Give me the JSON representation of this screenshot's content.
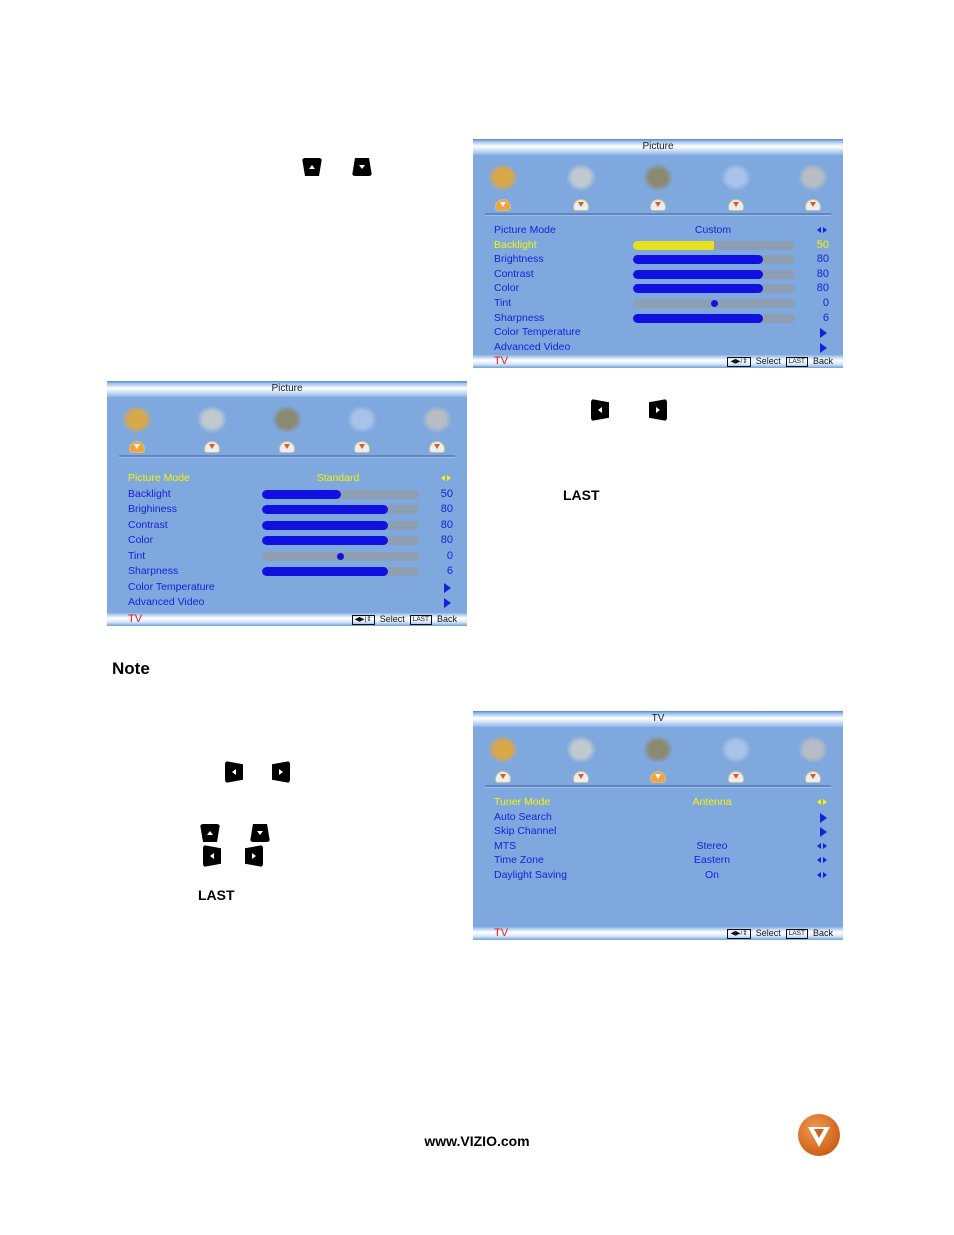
{
  "page": {
    "note_heading": "Note",
    "last_label_1": "LAST",
    "last_label_2": "LAST",
    "footer_url": "www.VIZIO.com",
    "logo": "vizio-logo"
  },
  "key_glyphs": {
    "top_keys": [
      "up-arrow-key",
      "down-arrow-key"
    ],
    "mid_keys": [
      "left-arrow-key",
      "right-arrow-key"
    ],
    "bottom_keys": [
      "left-arrow-key",
      "right-arrow-key",
      "up-arrow-key",
      "down-arrow-key",
      "left-arrow-key",
      "right-arrow-key"
    ]
  },
  "osd_menus": [
    {
      "id": "picture-custom",
      "title": "Picture",
      "active_tab": 0,
      "tabs": [
        "picture-icon",
        "audio-icon",
        "tv-icon",
        "setup-icon",
        "parental-icon"
      ],
      "rows": [
        {
          "label": "Picture Mode",
          "type": "choice",
          "value": "Custom",
          "selected": false
        },
        {
          "label": "Backlight",
          "type": "bar",
          "value": 50,
          "max": 100,
          "display": "50",
          "selected": true
        },
        {
          "label": "Brightness",
          "type": "bar",
          "value": 80,
          "max": 100,
          "display": "80",
          "selected": false
        },
        {
          "label": "Contrast",
          "type": "bar",
          "value": 80,
          "max": 100,
          "display": "80",
          "selected": false
        },
        {
          "label": "Color",
          "type": "bar",
          "value": 80,
          "max": 100,
          "display": "80",
          "selected": false
        },
        {
          "label": "Tint",
          "type": "center",
          "value": 0,
          "min": -50,
          "max": 50,
          "display": "0",
          "selected": false
        },
        {
          "label": "Sharpness",
          "type": "bar",
          "value": 6,
          "max": 7.5,
          "display": "6",
          "selected": false
        },
        {
          "label": "Color Temperature",
          "type": "submenu",
          "selected": false
        },
        {
          "label": "Advanced Video",
          "type": "submenu",
          "selected": false
        }
      ],
      "footer": {
        "source": "TV",
        "select_key": "◀▶/⇕",
        "select_label": "Select",
        "back_key": "LAST",
        "back_label": "Back"
      }
    },
    {
      "id": "picture-standard",
      "title": "Picture",
      "active_tab": 0,
      "tabs": [
        "picture-icon",
        "audio-icon",
        "tv-icon",
        "setup-icon",
        "parental-icon"
      ],
      "rows": [
        {
          "label": "Picture Mode",
          "type": "choice",
          "value": "Standard",
          "selected": true
        },
        {
          "label": "Backlight",
          "type": "bar",
          "value": 50,
          "max": 100,
          "display": "50",
          "selected": false
        },
        {
          "label": "Brighiness",
          "type": "bar",
          "value": 80,
          "max": 100,
          "display": "80",
          "selected": false
        },
        {
          "label": "Contrast",
          "type": "bar",
          "value": 80,
          "max": 100,
          "display": "80",
          "selected": false
        },
        {
          "label": "Color",
          "type": "bar",
          "value": 80,
          "max": 100,
          "display": "80",
          "selected": false
        },
        {
          "label": "Tint",
          "type": "center",
          "value": 0,
          "min": -50,
          "max": 50,
          "display": "0",
          "selected": false
        },
        {
          "label": "Sharpness",
          "type": "bar",
          "value": 6,
          "max": 7.5,
          "display": "6",
          "selected": false
        },
        {
          "label": "Color Temperature",
          "type": "submenu",
          "selected": false
        },
        {
          "label": "Advanced Video",
          "type": "submenu",
          "selected": false
        }
      ],
      "footer": {
        "source": "TV",
        "select_key": "◀▶|⇕",
        "select_label": "Select",
        "back_key": "LAST",
        "back_label": "Back"
      }
    },
    {
      "id": "tv-menu",
      "title": "TV",
      "active_tab": 2,
      "tabs": [
        "picture-icon",
        "audio-icon",
        "tv-icon",
        "setup-icon",
        "parental-icon"
      ],
      "rows": [
        {
          "label": "Tuner Mode",
          "type": "choice",
          "value": "Antenna",
          "selected": true
        },
        {
          "label": "Auto Search",
          "type": "submenu",
          "selected": false
        },
        {
          "label": "Skip Channel",
          "type": "submenu",
          "selected": false
        },
        {
          "label": "MTS",
          "type": "choice",
          "value": "Stereo",
          "selected": false
        },
        {
          "label": "Time Zone",
          "type": "choice",
          "value": "Eastern",
          "selected": false
        },
        {
          "label": "Daylight Saving",
          "type": "choice",
          "value": "On",
          "selected": false
        }
      ],
      "footer": {
        "source": "TV",
        "select_key": "◀▶/⇕",
        "select_label": "Select",
        "back_key": "LAST",
        "back_label": "Back"
      }
    }
  ]
}
